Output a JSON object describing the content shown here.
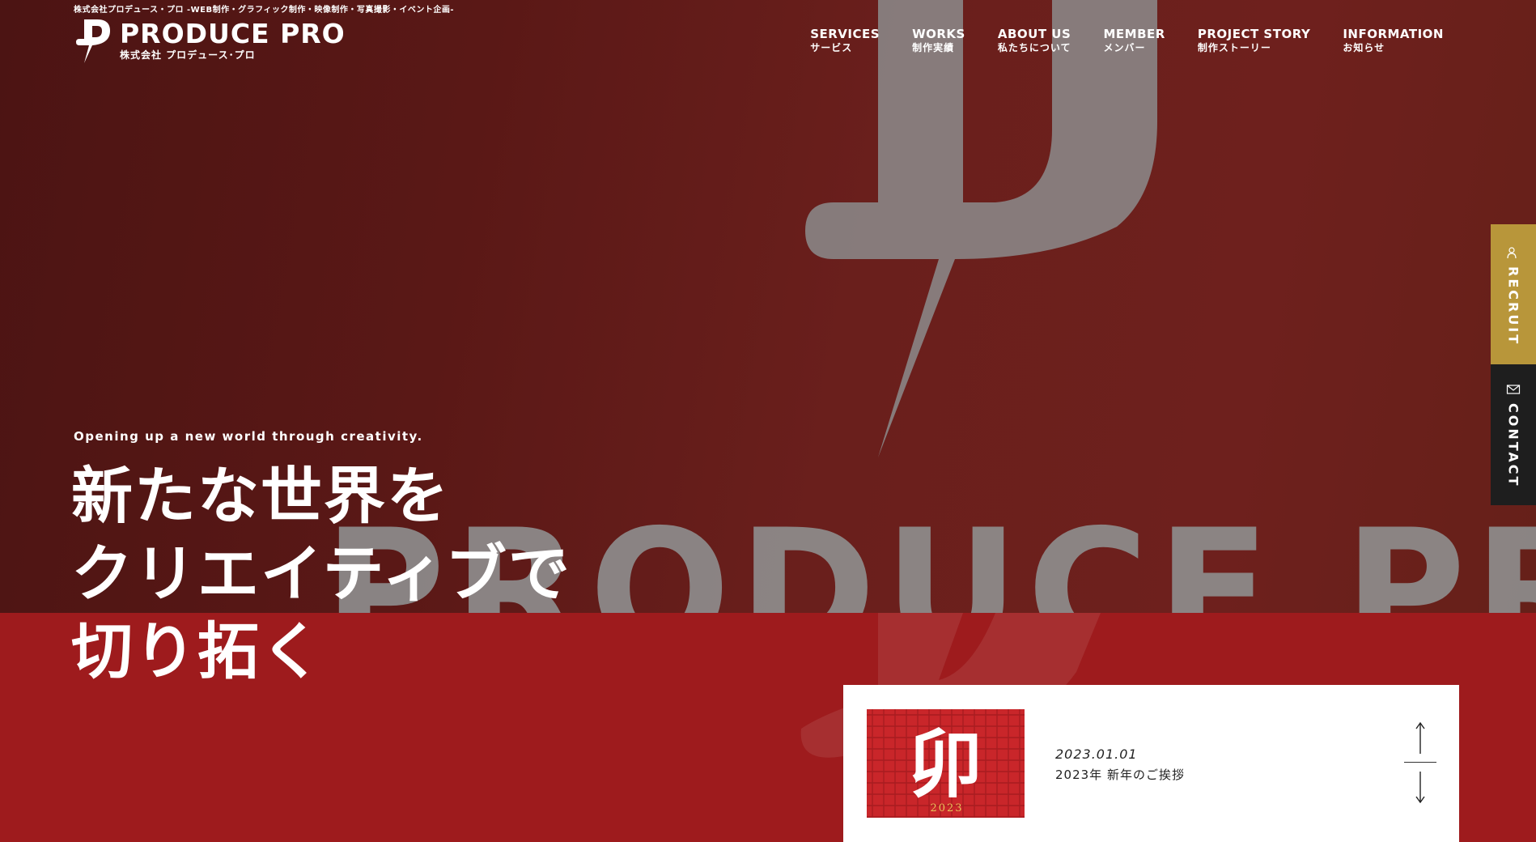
{
  "site": {
    "tagline": "株式会社プロデュース・プロ -WEB制作・グラフィック制作・映像制作・写真撮影・イベント企画-",
    "logo_name": "PRODUCE PRO",
    "logo_sub": "株式会社 プロデュース･プロ"
  },
  "nav": [
    {
      "en": "SERVICES",
      "ja": "サービス"
    },
    {
      "en": "WORKS",
      "ja": "制作実績"
    },
    {
      "en": "ABOUT US",
      "ja": "私たちについて"
    },
    {
      "en": "MEMBER",
      "ja": "メンバー"
    },
    {
      "en": "PROJECT STORY",
      "ja": "制作ストーリー"
    },
    {
      "en": "INFORMATION",
      "ja": "お知らせ"
    }
  ],
  "side_tabs": {
    "recruit": {
      "label": "RECRUIT",
      "icon": "person-icon",
      "color": "#b8963a"
    },
    "contact": {
      "label": "CONTACT",
      "icon": "mail-icon",
      "color": "#1e1e1e"
    }
  },
  "hero": {
    "copy_en": "Opening up a new world through creativity.",
    "copy_ja_lines": [
      "新たな世界を",
      "クリエイティブで",
      "切り拓く"
    ],
    "sign_text": "PRODUCE PRO"
  },
  "news": {
    "date": "2023.01.01",
    "title": "2023年 新年のご挨拶",
    "thumb_year": "2023",
    "thumb_char": "卯"
  },
  "colors": {
    "accent_red": "#9e1b1d",
    "hero_dark": "#5a1816",
    "gold": "#b8963a"
  }
}
